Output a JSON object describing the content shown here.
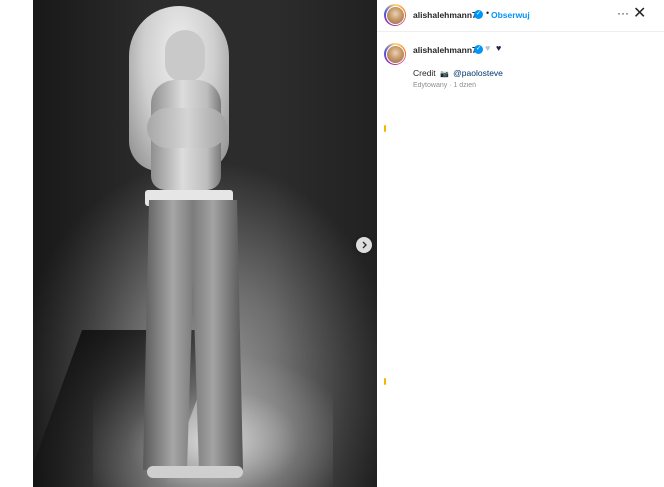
{
  "post": {
    "username": "alishalehmann7",
    "follow_label": "Obserwuj",
    "separator": "•",
    "more_label": "···",
    "close_label": "✕"
  },
  "caption": {
    "username": "alishalehmann7",
    "credit_label": "Credit",
    "camera_glyph": "📷",
    "mention": "@paolosteve",
    "edited_text": "Edytowany · 1 dzień",
    "heart_light": "♥",
    "heart_dark": "♥"
  },
  "icons": {
    "verified": "verified-badge-icon",
    "next": "chevron-right-icon",
    "camera": "camera-icon"
  },
  "colors": {
    "brand_blue": "#0095f6",
    "mention": "#00376b",
    "muted": "#8e8e8e",
    "accent_tick": "#f2b800"
  }
}
